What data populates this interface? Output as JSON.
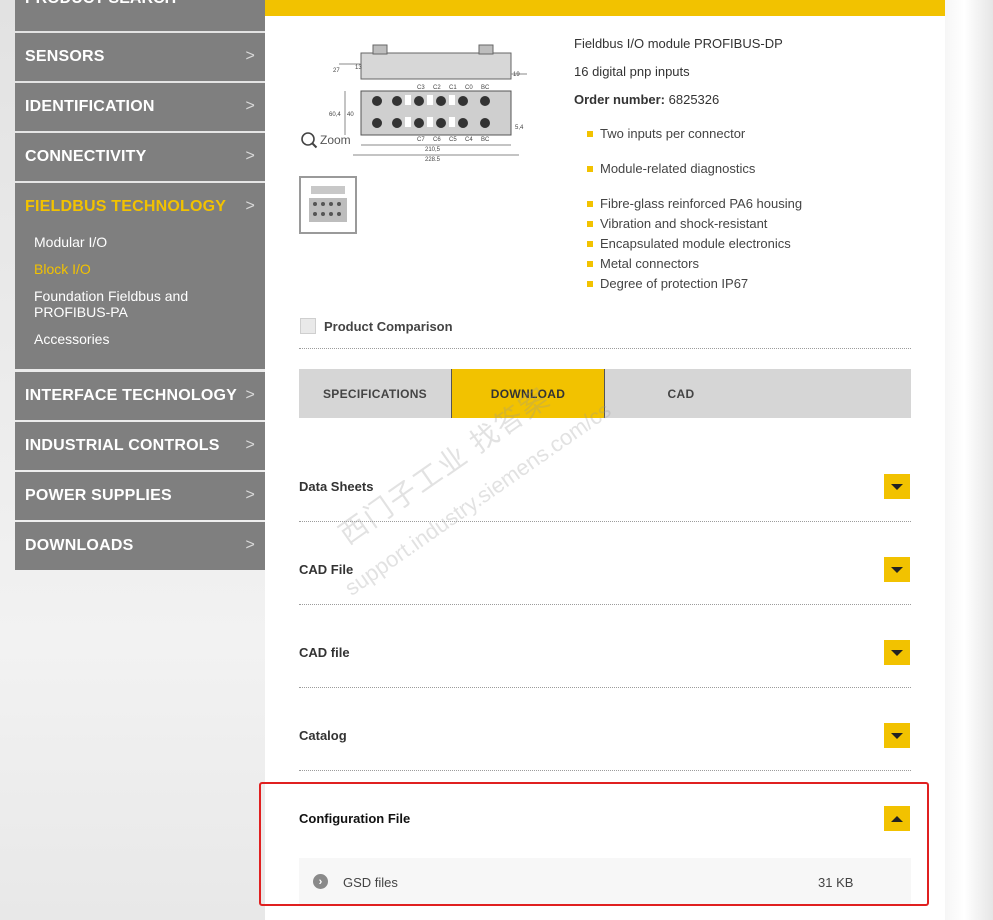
{
  "sidebar": {
    "cut_top_label": "PRODUCT SEARCH",
    "items": [
      {
        "label": "SENSORS"
      },
      {
        "label": "IDENTIFICATION"
      },
      {
        "label": "CONNECTIVITY"
      },
      {
        "label": "FIELDBUS TECHNOLOGY"
      },
      {
        "label": "INTERFACE TECHNOLOGY"
      },
      {
        "label": "INDUSTRIAL CONTROLS"
      },
      {
        "label": "POWER SUPPLIES"
      },
      {
        "label": "DOWNLOADS"
      }
    ],
    "chevron": ">",
    "subitems": [
      {
        "label": "Modular I/O"
      },
      {
        "label": "Block I/O"
      },
      {
        "label": "Foundation Fieldbus and PROFIBUS-PA"
      },
      {
        "label": "Accessories"
      }
    ]
  },
  "product": {
    "zoom_label": "Zoom",
    "title": "Fieldbus I/O module PROFIBUS-DP",
    "subtitle": "16 digital pnp inputs",
    "order_label": "Order number:",
    "order_number": "6825326",
    "features": [
      "Two inputs per connector",
      "Module-related diagnostics",
      "Fibre-glass reinforced PA6 housing",
      "Vibration and shock-resistant",
      "Encapsulated module electronics",
      "Metal connectors",
      "Degree of protection IP67"
    ],
    "drawing": {
      "top_labels": [
        "C3",
        "C2",
        "C1",
        "C0",
        "BC"
      ],
      "bottom_labels": [
        "C7",
        "C6",
        "C5",
        "C4",
        "BC"
      ],
      "dims": [
        "27",
        "13",
        "19",
        "60,4",
        "40",
        "5,4",
        "210,5",
        "228,5"
      ]
    }
  },
  "compare_label": "Product Comparison",
  "tabs": [
    {
      "label": "SPECIFICATIONS"
    },
    {
      "label": "DOWNLOAD"
    },
    {
      "label": "CAD"
    }
  ],
  "downloads": [
    {
      "label": "Data Sheets"
    },
    {
      "label": "CAD File"
    },
    {
      "label": "CAD file"
    },
    {
      "label": "Catalog"
    },
    {
      "label": "Configuration File"
    }
  ],
  "config_file": {
    "name": "GSD files",
    "size": "31 KB"
  },
  "watermark": {
    "line1": "西门子工业 找答案",
    "line2": "support.industry.siemens.com/cs"
  },
  "colors": {
    "accent": "#f2c200",
    "sidebar_bg": "#7f7f7f",
    "highlight_box": "#e02020"
  }
}
